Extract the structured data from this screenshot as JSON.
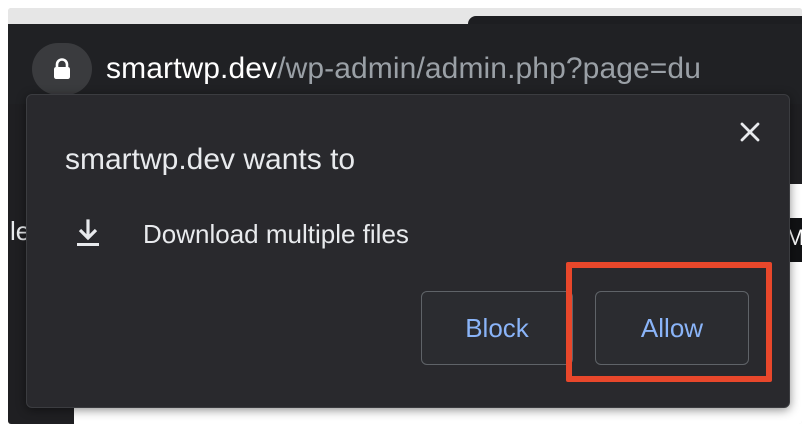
{
  "address_bar": {
    "domain": "smartwp.dev",
    "path": "/wp-admin/admin.php?page=du",
    "lock_icon": "lock-icon"
  },
  "page_background": {
    "left_edge_glyph": "le",
    "right_edge_glyph": "M"
  },
  "permission_prompt": {
    "title": "smartwp.dev wants to",
    "permission_icon": "download-icon",
    "permission_text": "Download multiple files",
    "close_icon": "close-icon",
    "block_label": "Block",
    "allow_label": "Allow"
  },
  "annotation": {
    "highlight_color": "#e8472b",
    "highlights": "allow-button"
  },
  "colors": {
    "dialog_bg": "#29292d",
    "button_text": "#8ab4f8",
    "url_domain": "#ffffff",
    "url_path": "#9aa0a6"
  }
}
